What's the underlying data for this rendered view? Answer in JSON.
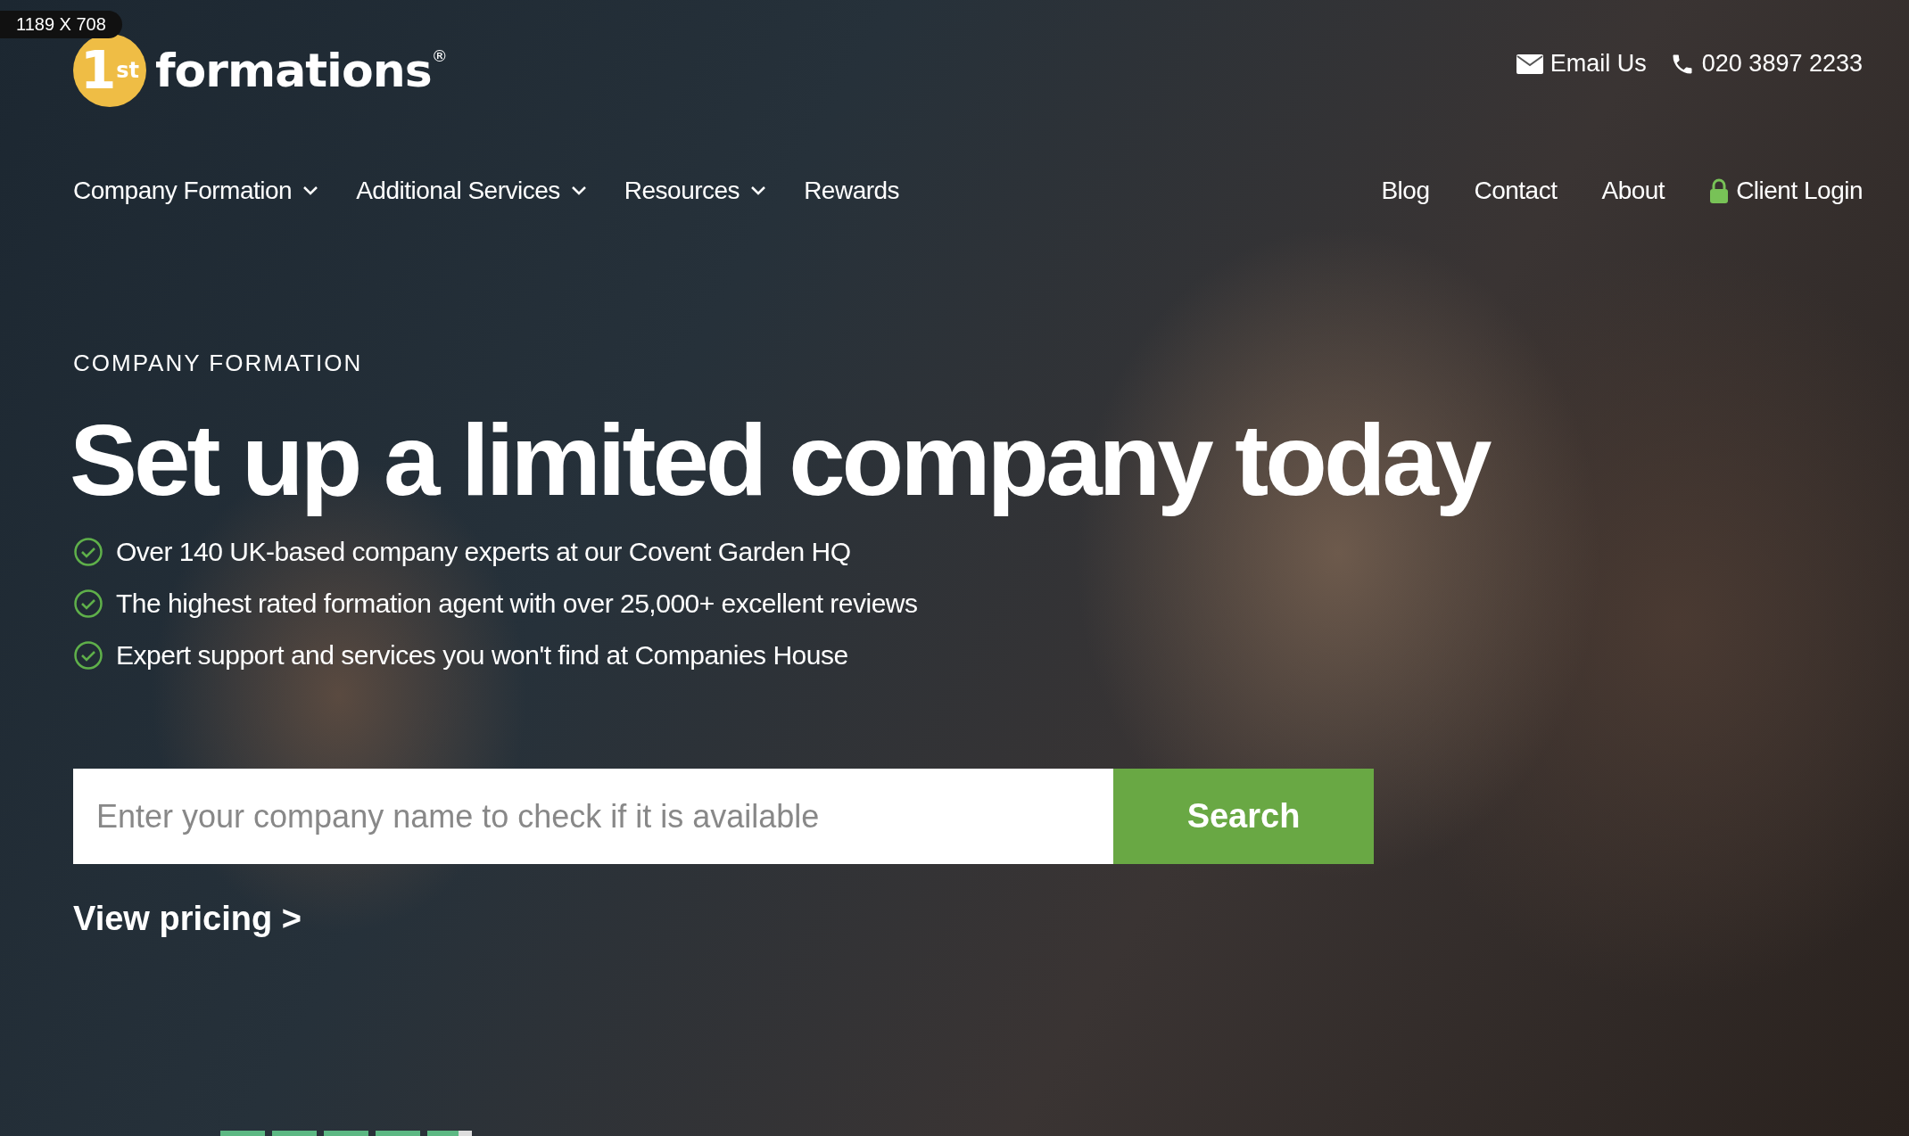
{
  "size_badge": "1189 X 708",
  "logo": {
    "mark": "1",
    "mark_suffix": "st",
    "word": "formations",
    "registered": "®"
  },
  "contact": {
    "email": "Email Us",
    "phone": "020 3897 2233"
  },
  "nav_left": [
    {
      "label": "Company Formation",
      "dropdown": true
    },
    {
      "label": "Additional Services",
      "dropdown": true
    },
    {
      "label": "Resources",
      "dropdown": true
    },
    {
      "label": "Rewards",
      "dropdown": false
    }
  ],
  "nav_right": [
    {
      "label": "Blog",
      "kind": "link"
    },
    {
      "label": "Contact",
      "kind": "link"
    },
    {
      "label": "About",
      "kind": "link"
    },
    {
      "label": "Client Login",
      "kind": "login"
    }
  ],
  "hero": {
    "eyebrow": "COMPANY FORMATION",
    "title": "Set up a limited company today",
    "bullets": [
      "Over 140 UK-based company experts at our Covent Garden HQ",
      "The highest rated formation agent with over 25,000+ excellent reviews",
      "Expert support and services you won't find at Companies House"
    ],
    "search": {
      "placeholder": "Enter your company name to check if it is available",
      "button": "Search"
    },
    "pricing_link": "View pricing >"
  },
  "rating": {
    "stars": 4.7
  }
}
